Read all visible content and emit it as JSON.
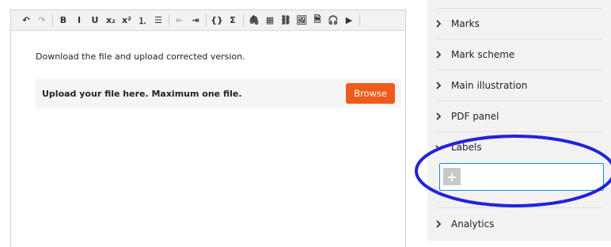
{
  "editor": {
    "toolbar": [
      {
        "name": "undo-icon",
        "glyph": "↶",
        "dim": false
      },
      {
        "name": "redo-icon",
        "glyph": "↷",
        "dim": true
      },
      {
        "sep": true
      },
      {
        "name": "bold-icon",
        "glyph": "B"
      },
      {
        "name": "italic-icon",
        "glyph": "I"
      },
      {
        "name": "underline-icon",
        "glyph": "U"
      },
      {
        "name": "subscript-icon",
        "glyph": "x₂"
      },
      {
        "name": "superscript-icon",
        "glyph": "x²"
      },
      {
        "name": "ordered-list-icon",
        "glyph": "⒈"
      },
      {
        "name": "bullet-list-icon",
        "glyph": "☰"
      },
      {
        "sep": true
      },
      {
        "name": "outdent-icon",
        "glyph": "⇤",
        "dim": true
      },
      {
        "name": "indent-icon",
        "glyph": "⇥"
      },
      {
        "sep": true
      },
      {
        "name": "code-braces-icon",
        "glyph": "{}"
      },
      {
        "name": "sigma-icon",
        "glyph": "Σ"
      },
      {
        "sep": true
      },
      {
        "name": "attachment-icon",
        "glyph": "🖇"
      },
      {
        "name": "table-icon",
        "glyph": "▦"
      },
      {
        "name": "link-icon",
        "glyph": "⛓"
      },
      {
        "name": "image-icon",
        "glyph": "🖼"
      },
      {
        "name": "pdf-icon",
        "glyph": "🗎"
      },
      {
        "name": "audio-icon",
        "glyph": "🎧"
      },
      {
        "name": "video-icon",
        "glyph": "▶"
      },
      {
        "sep": true
      }
    ],
    "instruction": "Download the file and upload corrected version.",
    "upload_label": "Upload your file here. Maximum one file.",
    "browse_label": "Browse",
    "accent_color": "#f05a1a"
  },
  "panel": {
    "items": [
      {
        "label": "Marks",
        "expanded": false
      },
      {
        "label": "Mark scheme",
        "expanded": false
      },
      {
        "label": "Main illustration",
        "expanded": false
      },
      {
        "label": "PDF panel",
        "expanded": false
      },
      {
        "label": "Labels",
        "expanded": true
      },
      {
        "label": "Analytics",
        "expanded": false
      }
    ],
    "add_label_glyph": "+",
    "highlight_color": "#2222dd"
  }
}
